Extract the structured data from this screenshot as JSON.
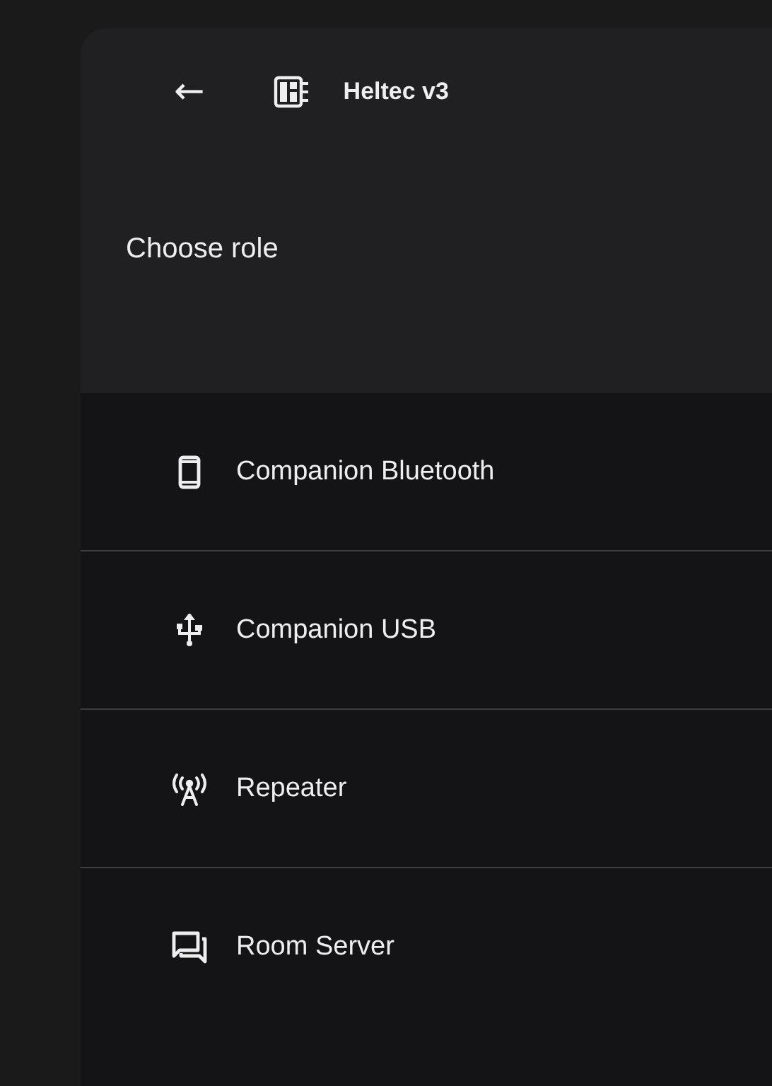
{
  "header": {
    "back": "←",
    "title": "Heltec v3"
  },
  "subtitle": "Choose role",
  "roles": [
    {
      "kind": "phone",
      "label": "Companion Bluetooth"
    },
    {
      "kind": "usb",
      "label": "Companion USB"
    },
    {
      "kind": "antenna",
      "label": "Repeater"
    },
    {
      "kind": "chat",
      "label": "Room Server"
    }
  ]
}
